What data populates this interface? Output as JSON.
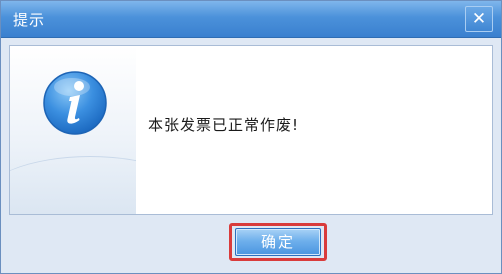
{
  "dialog": {
    "title": "提示",
    "close_label": "✕",
    "message": "本张发票已正常作废!",
    "ok_label": "确定"
  },
  "icons": {
    "info": "info-icon",
    "close": "close-icon"
  },
  "colors": {
    "titlebar": "#4b91da",
    "highlight_border": "#d93b3b",
    "button": "#6fb0ec"
  }
}
